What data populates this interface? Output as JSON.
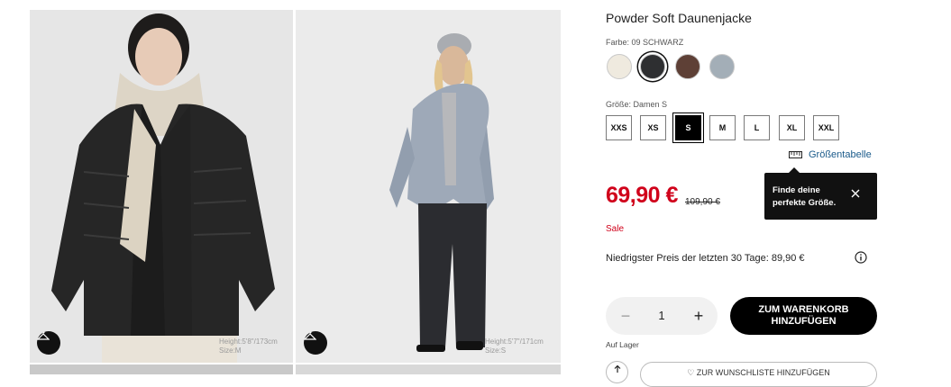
{
  "product": {
    "title": "Powder Soft Daunenjacke",
    "color_label": "Farbe: 09 SCHWARZ",
    "colors": [
      {
        "name": "beige",
        "hex": "#efeadf"
      },
      {
        "name": "schwarz",
        "hex": "#2e2f31",
        "selected": true
      },
      {
        "name": "braun",
        "hex": "#5e4036"
      },
      {
        "name": "hellblau",
        "hex": "#a3aeb7"
      }
    ],
    "size_label": "Größe: Damen S",
    "sizes": [
      {
        "label": "XXS"
      },
      {
        "label": "XS"
      },
      {
        "label": "S",
        "selected": true
      },
      {
        "label": "M"
      },
      {
        "label": "L"
      },
      {
        "label": "XL"
      },
      {
        "label": "XXL"
      }
    ],
    "size_chart_label": "Größentabelle",
    "price": "69,90 €",
    "old_price": "109,90 €",
    "sale_label": "Sale",
    "tooltip_text": "Finde deine perfekte Größe.",
    "lowest_price_text": "Niedrigster Preis der letzten 30 Tage: 89,90 €",
    "quantity": "1",
    "quantity_minus": "−",
    "quantity_plus": "+",
    "add_to_cart_label": "ZUM WARENKORB HINZUFÜGEN",
    "stock_label": "Auf Lager",
    "wishlist_label": "♡ ZUR WUNSCHLISTE HINZUFÜGEN"
  },
  "gallery": {
    "image1": {
      "height": "Height:5'8\"/173cm",
      "size": "Size:M"
    },
    "image2": {
      "height": "Height:5'7\"/171cm",
      "size": "Size:S"
    }
  },
  "colors": {
    "accent_red": "#d0021b",
    "link_blue": "#1a5a8a",
    "black": "#000000"
  }
}
